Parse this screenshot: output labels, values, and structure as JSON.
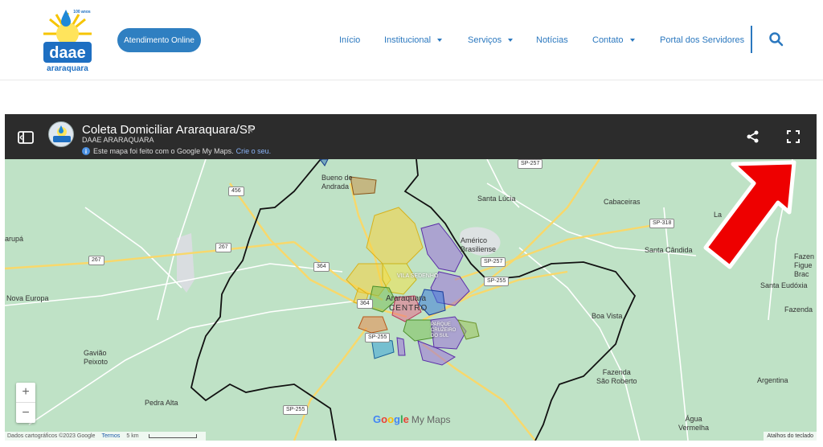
{
  "site": {
    "logo_text": "daae",
    "logo_sub": "araraquara",
    "logo_badge": "100 anos",
    "cta_label": "Atendimento Online",
    "nav": [
      {
        "label": "Início",
        "dropdown": false
      },
      {
        "label": "Institucional",
        "dropdown": true
      },
      {
        "label": "Serviços",
        "dropdown": true
      },
      {
        "label": "Notícias",
        "dropdown": false
      },
      {
        "label": "Contato",
        "dropdown": true
      },
      {
        "label": "Portal dos Servidores",
        "dropdown": false
      }
    ],
    "search_icon": "search-icon",
    "accent": "#2b78bf"
  },
  "map": {
    "title": "Coleta Domiciliar Araraquara/SP",
    "owner": "DAAE ARARAQUARA",
    "note": "Este mapa foi feito com o Google My Maps.",
    "note_link": "Crie o seu.",
    "header_bg": "#2c2c2c",
    "map_bg": "#bfe2c6",
    "labels": {
      "bueno_de_andrada": "Bueno de\nAndrada",
      "santa_lucia": "Santa Lúcia",
      "cabaceiras": "Cabaceiras",
      "la": "La",
      "americo": "Américo\nBrasiliense",
      "santa_candida": "Santa Cândida",
      "fazenda_figue": "Fazen\nFigue\nBrac",
      "arupa": "arupá",
      "nova_europa": "Nova Europa",
      "vila_sedenho": "VILA SEDENHO",
      "araraquara": "Araraquara",
      "centro": "CENTRO",
      "santa_eudoxia": "Santa Eudóxia",
      "fazenda_r": "Fazenda",
      "boa_vista": "Boa Vista",
      "gaviao": "Gavião\nPeixoto",
      "parque": "PARQUE\nCRUZEIRO\nDO SUL",
      "fazenda_sao_roberto": "Fazenda\nSão Roberto",
      "argentina": "Argentina",
      "pedra_alta": "Pedra Alta",
      "agua_vermelha": "Água\nVermelha"
    },
    "shields": {
      "sp257a": "SP-257",
      "sp257b": "SP-257",
      "sp318": "SP-318",
      "r456": "456",
      "r267a": "267",
      "r267b": "267",
      "r364a": "364",
      "r364b": "364",
      "sp255a": "SP-255",
      "sp255b": "SP-255",
      "sp255c": "SP-255"
    },
    "zoom_in": "+",
    "zoom_out": "−",
    "google": [
      "G",
      "o",
      "o",
      "g",
      "l",
      "e"
    ],
    "google_colors": [
      "#4285f4",
      "#ea4335",
      "#fbbc05",
      "#4285f4",
      "#34a853",
      "#ea4335"
    ],
    "mymaps": "My Maps",
    "attribution": "Dados cartográficos ©2023 Google",
    "terms": "Termos",
    "scale": "5 km",
    "keyboard": "Atalhos do teclado"
  },
  "annotation": {
    "arrow_color": "#ee0000"
  }
}
